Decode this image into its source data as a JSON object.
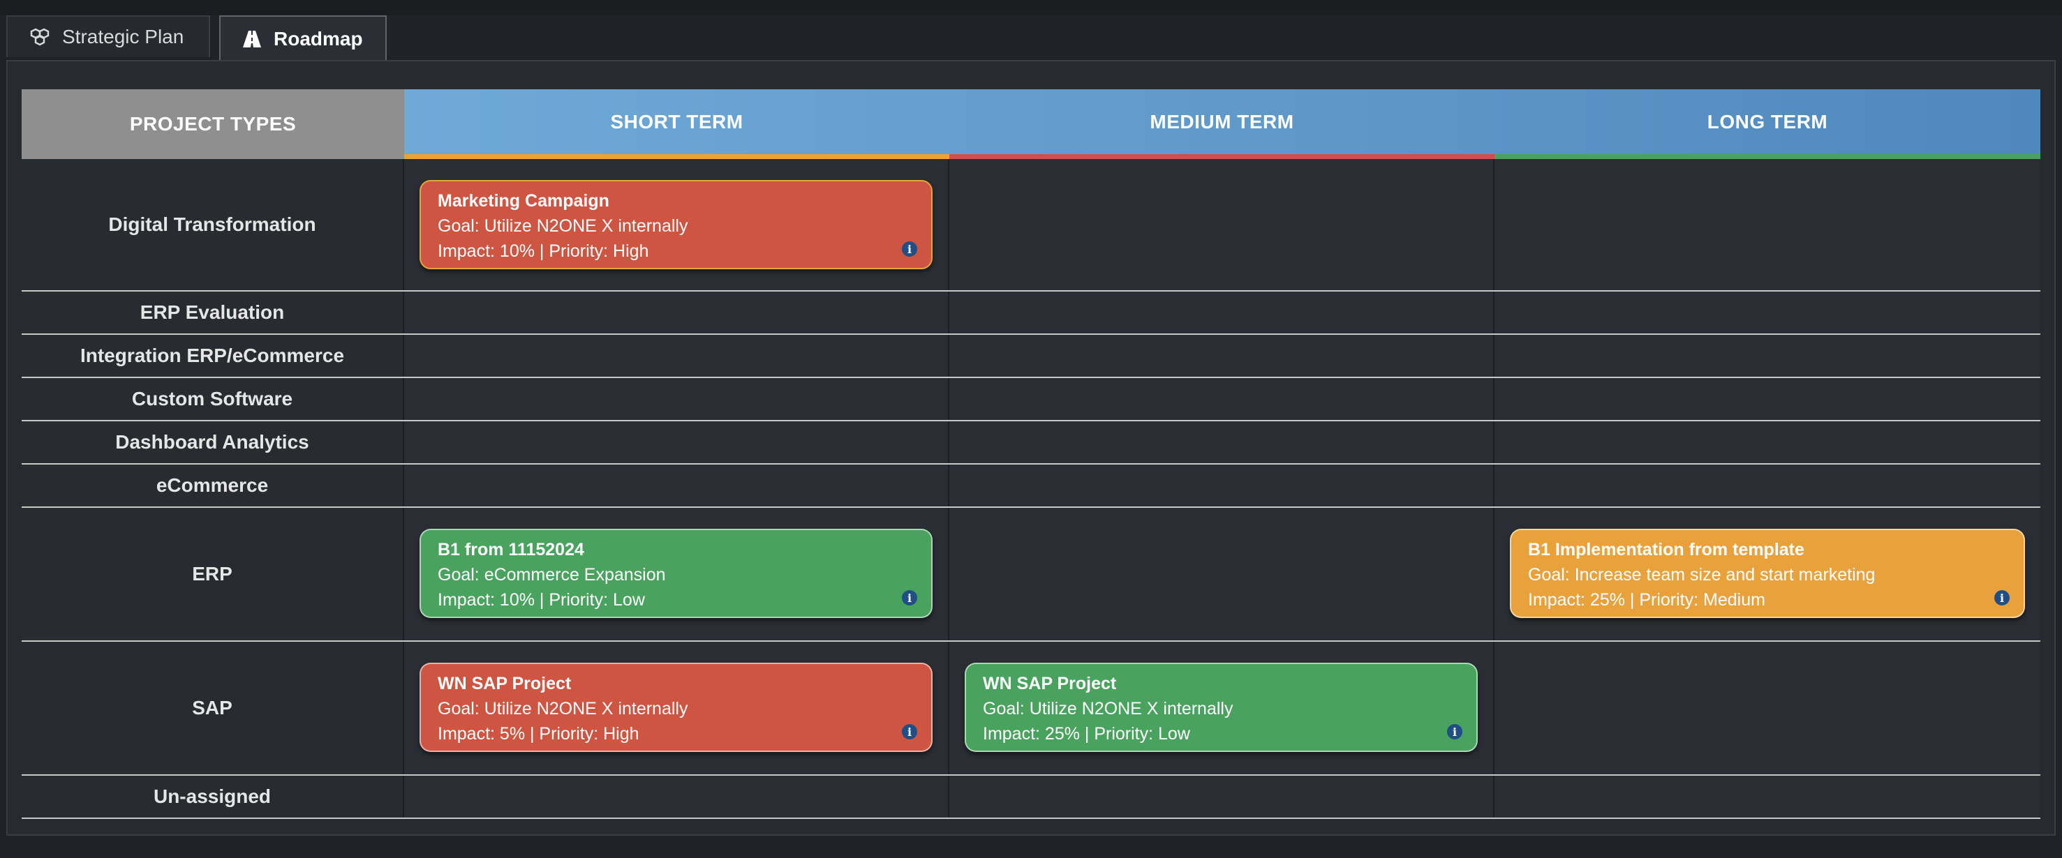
{
  "tabs": [
    {
      "label": "Strategic Plan",
      "icon": "cubes-icon",
      "active": false
    },
    {
      "label": "Roadmap",
      "icon": "road-icon",
      "active": true
    }
  ],
  "header": {
    "types": "PROJECT TYPES",
    "short": "SHORT TERM",
    "medium": "MEDIUM TERM",
    "long": "LONG TERM",
    "short_color": "#e8a33a",
    "medium_color": "#c9534a",
    "long_color": "#49a35e"
  },
  "colors": {
    "red": "#cd5541",
    "green": "#49a35e",
    "orange": "#e9a23b"
  },
  "rows": [
    {
      "label": "Digital Transformation"
    },
    {
      "label": "ERP Evaluation"
    },
    {
      "label": "Integration ERP/eCommerce"
    },
    {
      "label": "Custom Software"
    },
    {
      "label": "Dashboard Analytics"
    },
    {
      "label": "eCommerce"
    },
    {
      "label": "ERP"
    },
    {
      "label": "SAP"
    },
    {
      "label": "Un-assigned"
    }
  ],
  "cards": {
    "marketing": {
      "title": "Marketing Campaign",
      "goal": "Goal: Utilize N2ONE X internally",
      "meta": "Impact: 10% | Priority: High"
    },
    "b1": {
      "title": "B1 from 11152024",
      "goal": "Goal: eCommerce Expansion",
      "meta": "Impact: 10% | Priority: Low"
    },
    "b1impl": {
      "title": "B1 Implementation from template",
      "goal": "Goal: Increase team size and start marketing",
      "meta": "Impact: 25% | Priority: Medium"
    },
    "sap_short": {
      "title": "WN SAP Project",
      "goal": "Goal: Utilize N2ONE X internally",
      "meta": "Impact: 5% | Priority: High"
    },
    "sap_medium": {
      "title": "WN SAP Project",
      "goal": "Goal: Utilize N2ONE X internally",
      "meta": "Impact: 25% | Priority: Low"
    }
  }
}
